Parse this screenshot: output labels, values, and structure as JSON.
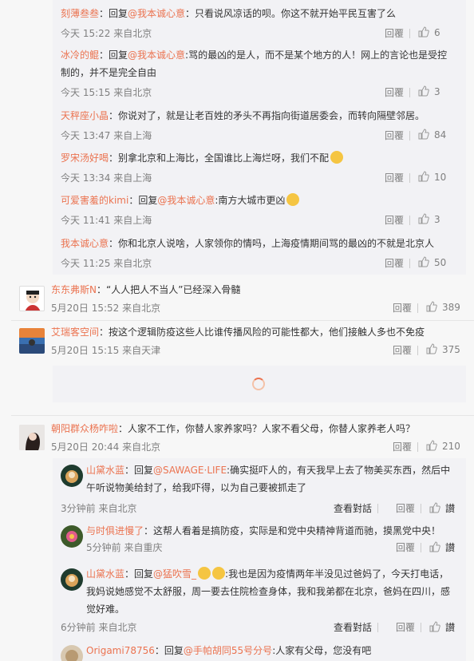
{
  "top_replies": [
    {
      "user": "刻薄叁叁",
      "prefix": "：回复",
      "mention": "@我本诚心意",
      "text": "：只看说风凉话的呗。你这不就开始平民互害了么",
      "time": "今天 15:22 来自北京",
      "reply": "回覆",
      "likes": "6"
    },
    {
      "user": "冰冷的鲲",
      "prefix": "：回复",
      "mention": "@我本诚心意",
      "text": ":骂的最凶的是人，而不是某个地方的人！网上的言论也是受控制的，并不是完全自由",
      "time": "今天 15:15 来自北京",
      "reply": "回覆",
      "likes": "3"
    },
    {
      "user": "天秤座小晶",
      "prefix": "：",
      "mention": "",
      "text": "你说对了，就是让老百姓的矛头不再指向街道居委会，而转向隔壁邻居。",
      "time": "今天 13:47 来自上海",
      "reply": "回覆",
      "likes": "84"
    },
    {
      "user": "罗宋汤好喝",
      "prefix": "：",
      "mention": "",
      "text": "别拿北京和上海比，全国谁比上海烂呀，我们不配",
      "time": "今天 13:34 来自上海",
      "reply": "回覆",
      "likes": "10"
    },
    {
      "user": "可爱害羞的kimi",
      "prefix": "：回复",
      "mention": "@我本诚心意",
      "text": ":南方大城市更凶",
      "time": "今天 11:41 来自上海",
      "reply": "回覆",
      "likes": "3"
    },
    {
      "user": "我本诚心意",
      "prefix": "：",
      "mention": "",
      "text": "你和北京人说啥，人家领你的情吗，上海疫情期间骂的最凶的不就是北京人",
      "time": "今天 11:25 来自北京",
      "reply": "回覆",
      "likes": "50"
    }
  ],
  "comments": [
    {
      "user": "东东弗斯N",
      "text": "“人人把人不当人”已经深入骨髓",
      "time": "5月20日 15:52 来自北京",
      "reply": "回覆",
      "likes": "389"
    },
    {
      "user": "艾瑞客空间",
      "text": "按这个逻辑防疫这些人比谁传播风险的可能性都大，他们接触人多也不免疫",
      "time": "5月20日 15:15 来自天津",
      "reply": "回覆",
      "likes": "375"
    },
    {
      "user": "朝阳群众杨咋啦",
      "text": "人家不工作，你替人家养家吗？人家不看父母，你替人家养老人吗？",
      "time": "5月20日 20:44 来自北京",
      "reply": "回覆",
      "likes": "210"
    }
  ],
  "sub_replies": [
    {
      "user": "山黛水蓝",
      "prefix": "：回复",
      "mention": "@SAWAGE·LIFE",
      "text": ":确实挺吓人的，有天我早上去了物美买东西，然后中午听说物美给封了，给我吓得，以为自己要被抓走了",
      "time": "3分钟前 来自北京",
      "view": "查看對話",
      "reply": "回覆",
      "likes": "讃"
    },
    {
      "user": "与时俱进慢了",
      "prefix": "：",
      "mention": "",
      "text": "这帮人看着是搞防疫，实际是和党中央精神背道而驰，摸黑党中央！",
      "time": "5分钟前 来自重庆",
      "view": "",
      "reply": "回覆",
      "likes": "讃"
    },
    {
      "user": "山黛水蓝",
      "prefix": "：回复",
      "mention": "@猛吹雪_",
      "text": ":我也是因为疫情两年半没见过爸妈了，今天打电话，我妈说她感觉不太舒服，周一要去住院检查身体，我和我弟都在北京，爸妈在四川，感觉好难。",
      "time": "6分钟前 来自北京",
      "view": "查看對話",
      "reply": "回覆",
      "likes": "讃"
    },
    {
      "user": "Origami78756",
      "prefix": "：回复",
      "mention": "@手帕胡同55号分号",
      "text": ":人家有父母，您没有吧",
      "time": "",
      "view": "",
      "reply": "",
      "likes": ""
    }
  ]
}
